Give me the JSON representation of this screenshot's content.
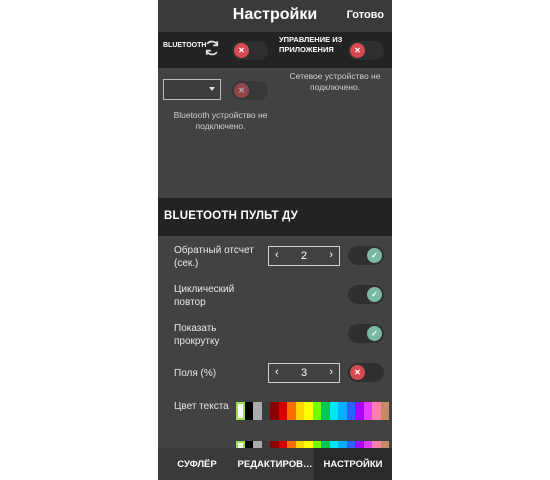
{
  "header": {
    "title": "Настройки",
    "done_label": "Готово"
  },
  "connection": {
    "bluetooth_label": "BLUETOOTH",
    "bluetooth_toggle": "off",
    "app_control_label": "УПРАВЛЕНИЕ ИЗ ПРИЛОЖЕНИЯ",
    "app_control_toggle": "off",
    "device_dropdown_value": "",
    "network_status": "Сетевое устройство не подключено.",
    "bluetooth_status": "Bluetooth устройство не подключено."
  },
  "remote_section": {
    "title": "BLUETOOTH ПУЛЬТ ДУ",
    "rows": [
      {
        "label": "Обратный отсчет (сек.)",
        "stepper_value": "2",
        "toggle": "on"
      },
      {
        "label": "Циклический повтор",
        "toggle": "on"
      },
      {
        "label": "Показать прокрутку",
        "toggle": "on"
      },
      {
        "label": "Поля (%)",
        "stepper_value": "3",
        "toggle": "off"
      },
      {
        "label": "Цвет текста"
      }
    ],
    "stepper_dec_symbol": "‹",
    "stepper_inc_symbol": "›"
  },
  "palette": [
    "#ffffff",
    "#000000",
    "#aaaaaa",
    "#3c3c3c",
    "#8b0000",
    "#d50000",
    "#ff6d00",
    "#ffd600",
    "#ffff00",
    "#76ff03",
    "#00c853",
    "#00e5ff",
    "#00b0ff",
    "#2962ff",
    "#aa00ff",
    "#e040fb",
    "#ff80ab",
    "#c68a64"
  ],
  "selected_text_color": "#ffffff",
  "bottom_nav": {
    "tabs": [
      "СУФЛЁР",
      "РЕДАКТИРОВ…",
      "НАСТРОЙКИ"
    ],
    "active_tab": "НАСТРОЙКИ"
  },
  "colors": {
    "toggle_off": "#d64b52",
    "toggle_on": "#7bb8a4",
    "panel_bg": "#424242",
    "header_bg": "#232323"
  }
}
